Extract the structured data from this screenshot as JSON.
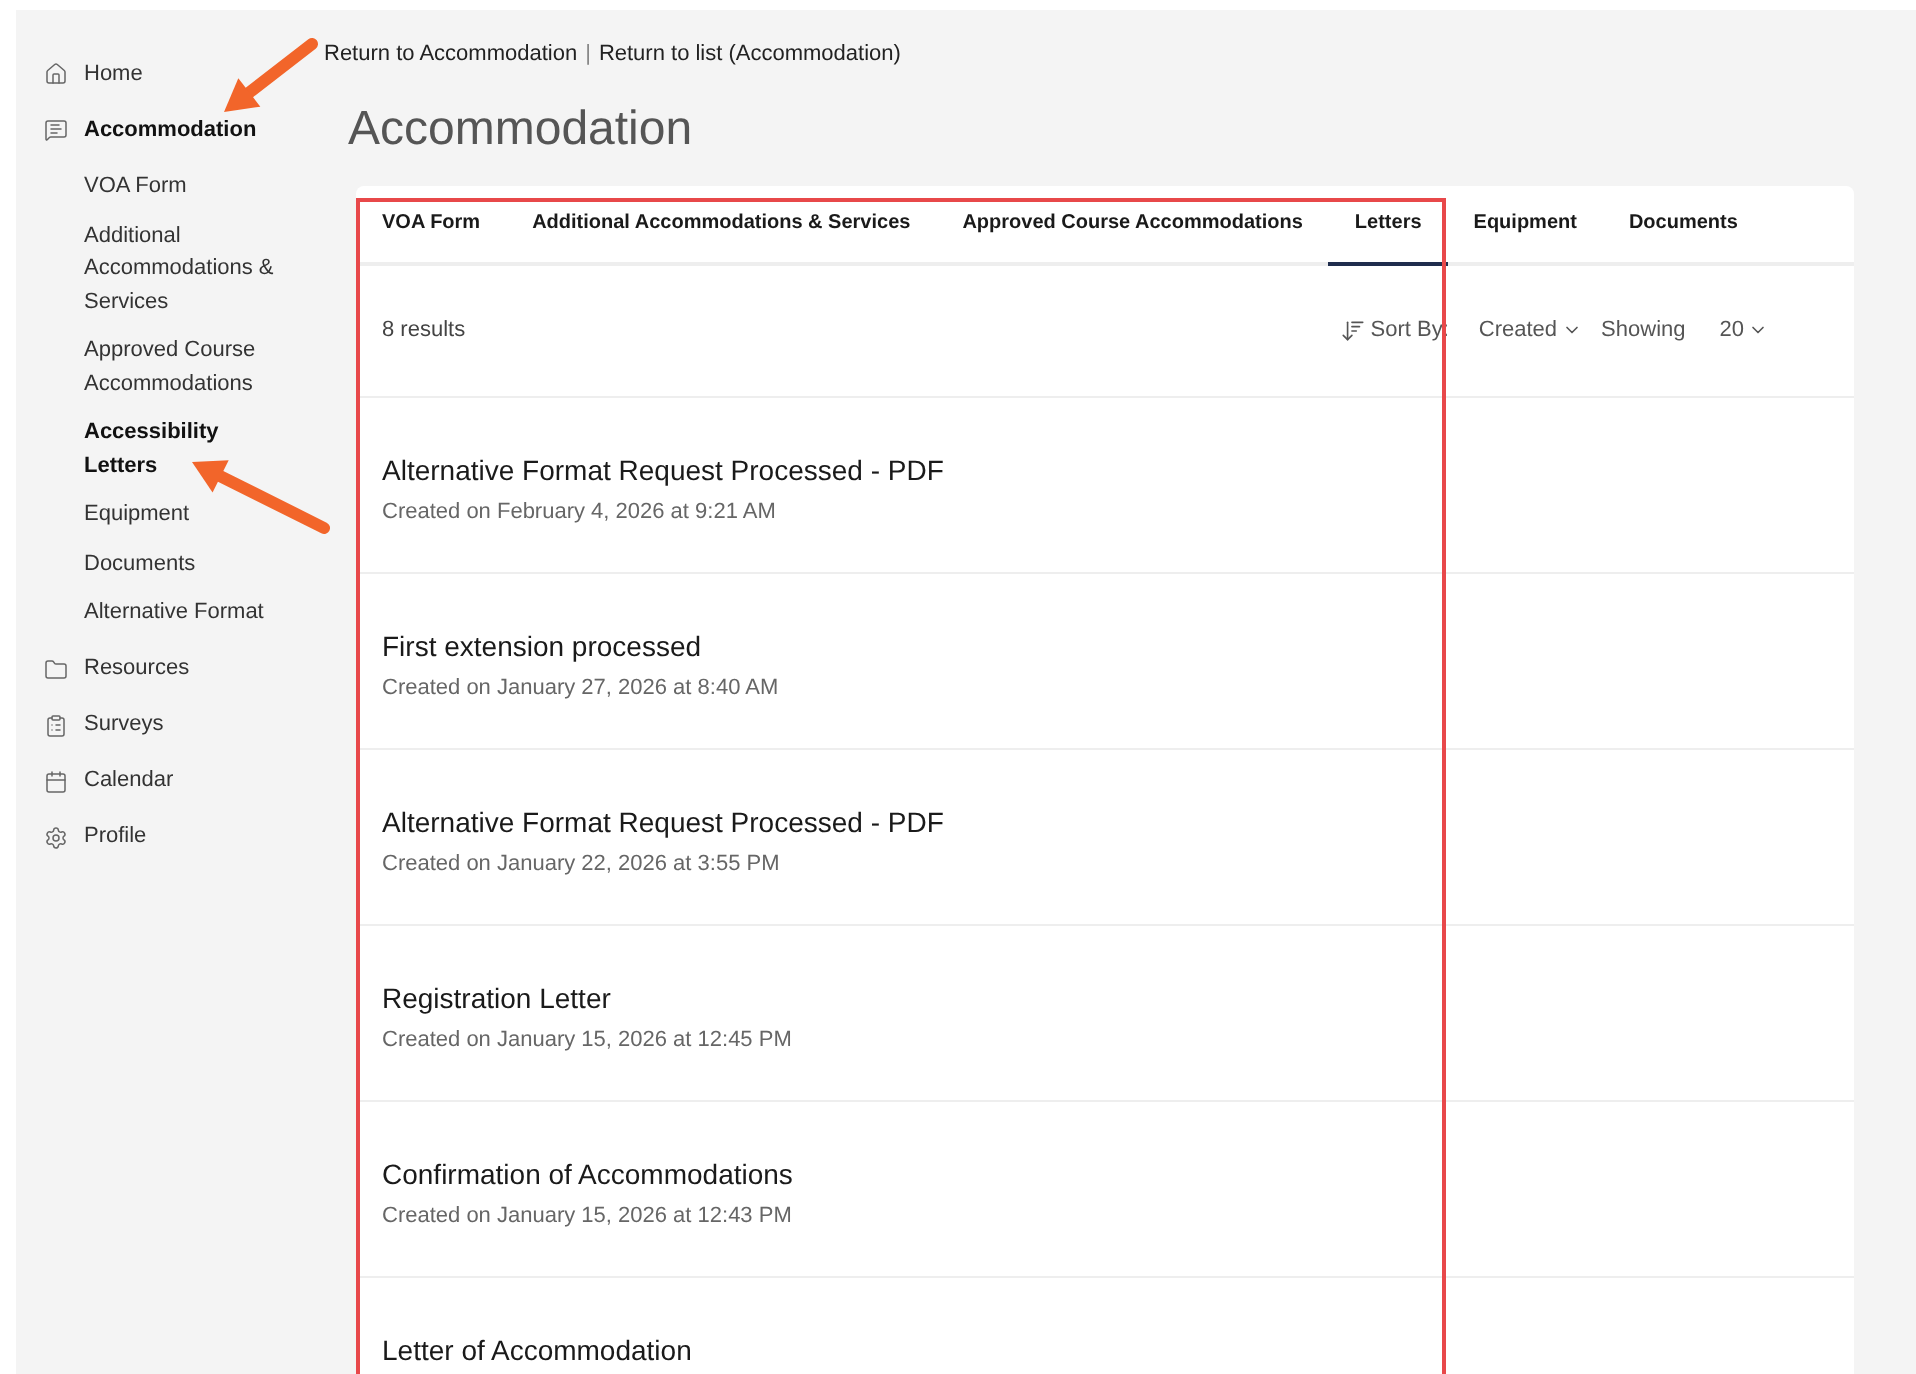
{
  "sidebar": {
    "items": [
      {
        "label": "Home",
        "selected": false
      },
      {
        "label": "Accommodation",
        "selected": true,
        "children": [
          {
            "label": "VOA Form",
            "selected": false
          },
          {
            "label": "Additional Accommodations & Services",
            "selected": false
          },
          {
            "label": "Approved Course Accommodations",
            "selected": false
          },
          {
            "label": "Accessibility Letters",
            "selected": true
          },
          {
            "label": "Equipment",
            "selected": false
          },
          {
            "label": "Documents",
            "selected": false
          },
          {
            "label": "Alternative Format",
            "selected": false
          }
        ]
      },
      {
        "label": "Resources",
        "selected": false
      },
      {
        "label": "Surveys",
        "selected": false
      },
      {
        "label": "Calendar",
        "selected": false
      },
      {
        "label": "Profile",
        "selected": false
      }
    ]
  },
  "breadcrumb": {
    "links": [
      "Return to Accommodation",
      "Return to list (Accommodation)"
    ],
    "separator": "|"
  },
  "page_title": "Accommodation",
  "tabs": [
    {
      "label": "VOA Form",
      "selected": false
    },
    {
      "label": "Additional Accommodations & Services",
      "selected": false
    },
    {
      "label": "Approved Course Accommodations",
      "selected": false
    },
    {
      "label": "Letters",
      "selected": true
    },
    {
      "label": "Equipment",
      "selected": false
    },
    {
      "label": "Documents",
      "selected": false
    }
  ],
  "results": {
    "count": "8 results",
    "sort_label": "Sort By:",
    "sort_value": "Created",
    "showing_label": "Showing",
    "showing_value": "20"
  },
  "letters": [
    {
      "title": "Alternative Format Request Processed - PDF",
      "created": "Created on February 4, 2026 at 9:21 AM"
    },
    {
      "title": "First extension processed",
      "created": "Created on January 27, 2026 at 8:40 AM"
    },
    {
      "title": "Alternative Format Request Processed - PDF",
      "created": "Created on January 22, 2026 at 3:55 PM"
    },
    {
      "title": "Registration Letter",
      "created": "Created on January 15, 2026 at 12:45 PM"
    },
    {
      "title": "Confirmation of Accommodations",
      "created": "Created on January 15, 2026 at 12:43 PM"
    },
    {
      "title": "Letter of Accommodation"
    }
  ]
}
